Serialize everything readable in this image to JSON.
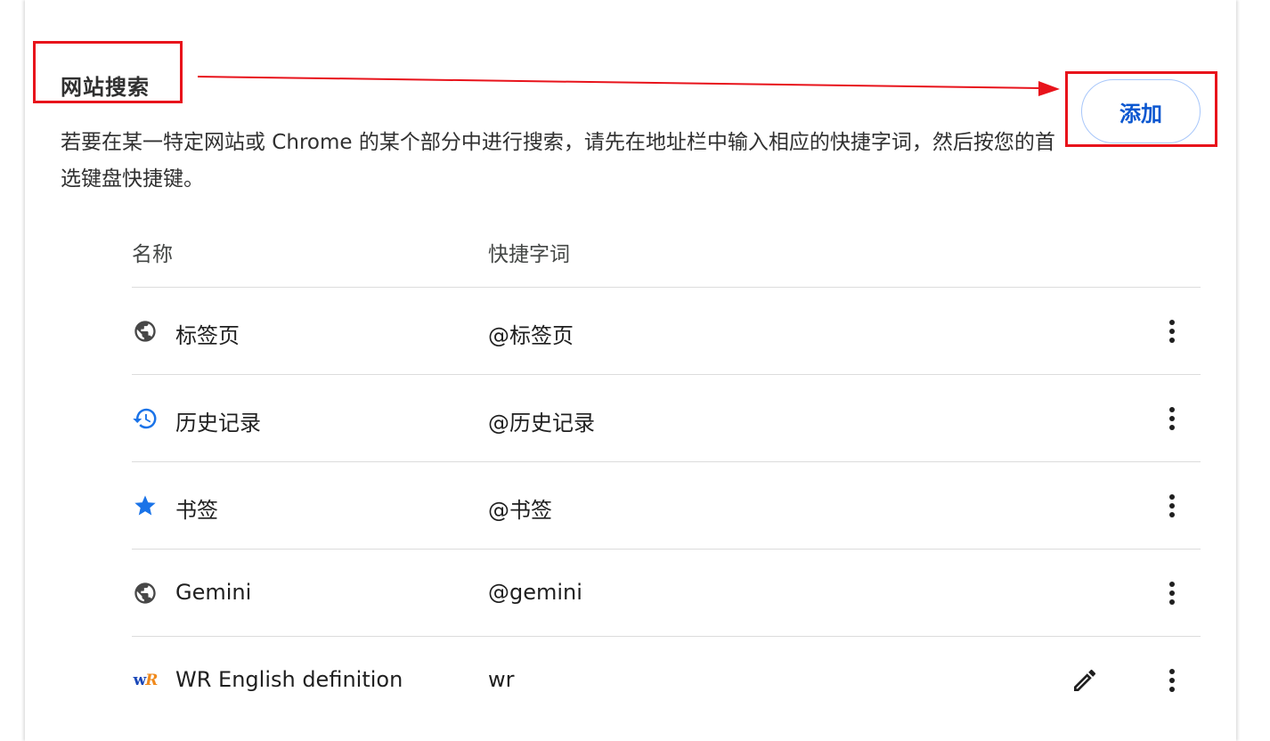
{
  "section": {
    "title": "网站搜索",
    "description": "若要在某一特定网站或 Chrome 的某个部分中进行搜索，请先在地址栏中输入相应的快捷字词，然后按您的首选键盘快捷键。",
    "add_button_label": "添加"
  },
  "table": {
    "headers": {
      "name": "名称",
      "keyword": "快捷字词"
    },
    "rows": [
      {
        "name": "标签页",
        "keyword": "@标签页",
        "icon": "globe-icon"
      },
      {
        "name": "历史记录",
        "keyword": "@历史记录",
        "icon": "history-icon"
      },
      {
        "name": "书签",
        "keyword": "@书签",
        "icon": "star-icon"
      },
      {
        "name": "Gemini",
        "keyword": "@gemini",
        "icon": "globe-icon"
      },
      {
        "name": "WR English definition",
        "keyword": "wr",
        "icon": "wordreference-logo-icon",
        "editable": true
      }
    ]
  },
  "logo_text": {
    "w": "w",
    "r": "R"
  },
  "colors": {
    "accent": "#0b57d0",
    "icon_blue": "#1a73e8",
    "icon_grey": "#474747",
    "annotation_red": "#e8131b",
    "divider": "#dcdcdc"
  }
}
